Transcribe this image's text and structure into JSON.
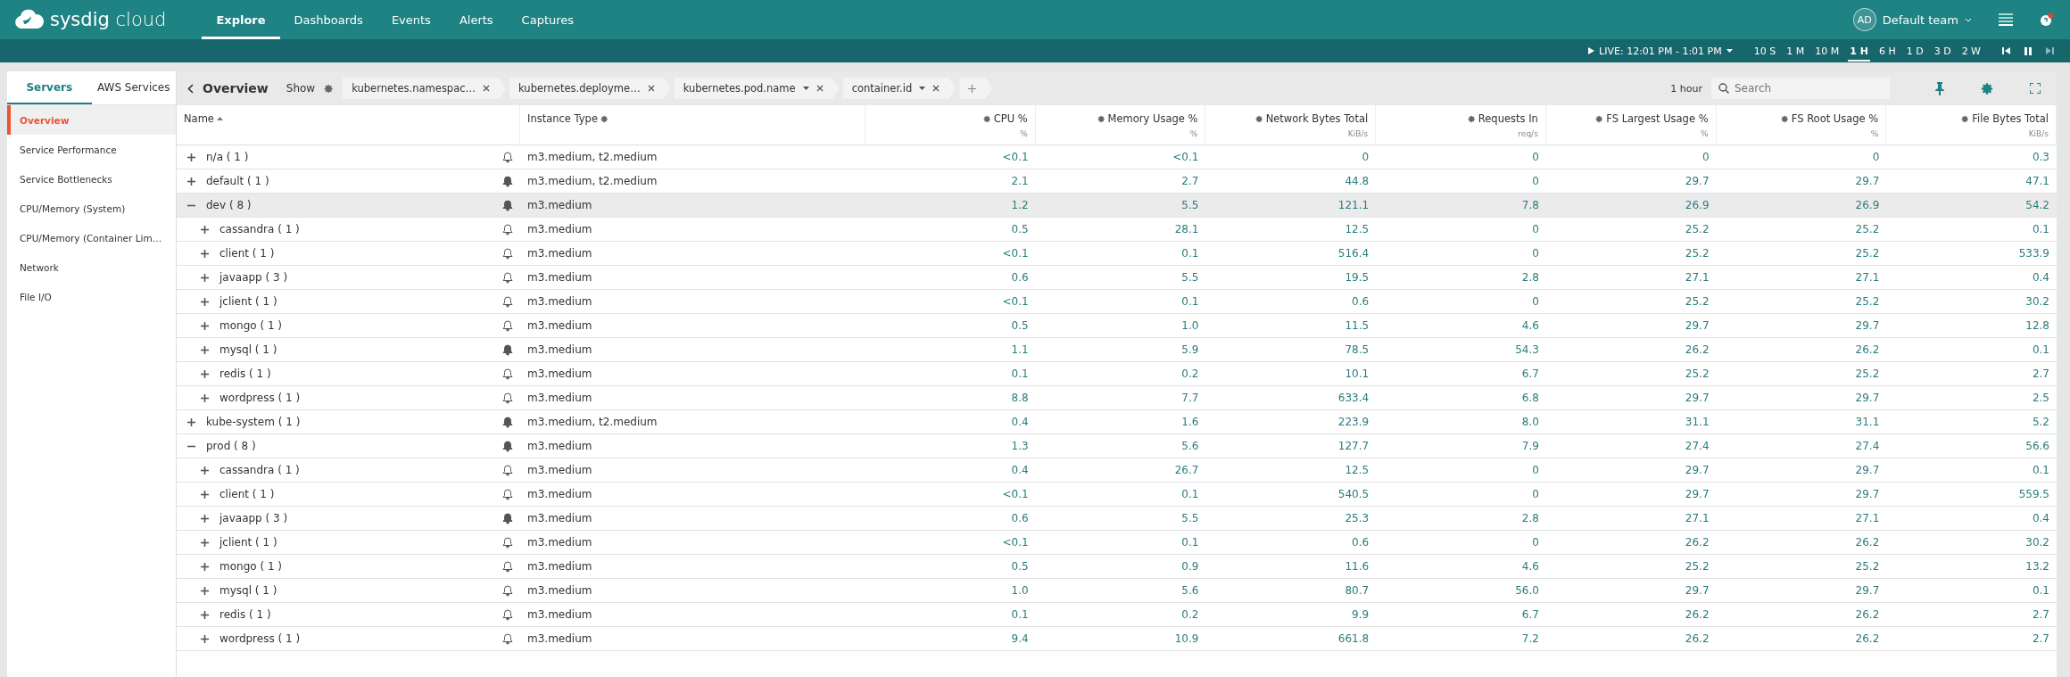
{
  "brand": {
    "name": "sysdig",
    "suffix": "cloud"
  },
  "nav": [
    {
      "label": "Explore",
      "selected": true
    },
    {
      "label": "Dashboards",
      "selected": false
    },
    {
      "label": "Events",
      "selected": false
    },
    {
      "label": "Alerts",
      "selected": false
    },
    {
      "label": "Captures",
      "selected": false
    }
  ],
  "team": {
    "initials": "AD",
    "name": "Default team"
  },
  "timebar": {
    "live": "LIVE: 12:01 PM - 1:01 PM",
    "ranges": [
      {
        "label": "10 S",
        "selected": false
      },
      {
        "label": "1 M",
        "selected": false
      },
      {
        "label": "10 M",
        "selected": false
      },
      {
        "label": "1 H",
        "selected": true
      },
      {
        "label": "6 H",
        "selected": false
      },
      {
        "label": "1 D",
        "selected": false
      },
      {
        "label": "3 D",
        "selected": false
      },
      {
        "label": "2 W",
        "selected": false
      }
    ]
  },
  "sidebar": {
    "tabs": [
      {
        "label": "Servers",
        "selected": true
      },
      {
        "label": "AWS Services",
        "selected": false
      }
    ],
    "items": [
      {
        "label": "Overview",
        "selected": true
      },
      {
        "label": "Service Performance",
        "selected": false
      },
      {
        "label": "Service Bottlenecks",
        "selected": false
      },
      {
        "label": "CPU/Memory (System)",
        "selected": false
      },
      {
        "label": "CPU/Memory (Container Lim…",
        "selected": false
      },
      {
        "label": "Network",
        "selected": false
      },
      {
        "label": "File I/O",
        "selected": false
      }
    ]
  },
  "toolbar": {
    "title": "Overview",
    "show": "Show",
    "chips": [
      {
        "label": "kubernetes.namespac…",
        "dropdown": false
      },
      {
        "label": "kubernetes.deployme…",
        "dropdown": false
      },
      {
        "label": "kubernetes.pod.name",
        "dropdown": true
      },
      {
        "label": "container.id",
        "dropdown": true
      }
    ],
    "range": "1 hour",
    "search": {
      "placeholder": "Search"
    }
  },
  "table": {
    "columns": [
      {
        "label": "Name",
        "kind": "name"
      },
      {
        "label": "Instance Type",
        "kind": "text"
      },
      {
        "label": "CPU %",
        "unit": "%",
        "kind": "num"
      },
      {
        "label": "Memory Usage %",
        "unit": "%",
        "kind": "num"
      },
      {
        "label": "Network Bytes Total",
        "unit": "KiB/s",
        "kind": "num"
      },
      {
        "label": "Requests In",
        "unit": "req/s",
        "kind": "num"
      },
      {
        "label": "FS Largest Usage %",
        "unit": "%",
        "kind": "num"
      },
      {
        "label": "FS Root Usage %",
        "unit": "%",
        "kind": "num"
      },
      {
        "label": "File Bytes Total",
        "unit": "KiB/s",
        "kind": "num"
      }
    ],
    "rows": [
      {
        "name": "n/a ( 1 )",
        "expanded": false,
        "selected": false,
        "alert": false,
        "instance": "m3.medium, t2.medium",
        "values": [
          "<0.1",
          "<0.1",
          "0",
          "0",
          "0",
          "0",
          "0.3"
        ]
      },
      {
        "name": "default ( 1 )",
        "expanded": false,
        "selected": false,
        "alert": true,
        "instance": "m3.medium, t2.medium",
        "values": [
          "2.1",
          "2.7",
          "44.8",
          "0",
          "29.7",
          "29.7",
          "47.1"
        ]
      },
      {
        "name": "dev ( 8 )",
        "expanded": true,
        "selected": true,
        "alert": true,
        "instance": "m3.medium",
        "values": [
          "1.2",
          "5.5",
          "121.1",
          "7.8",
          "26.9",
          "26.9",
          "54.2"
        ],
        "children": [
          {
            "name": "cassandra ( 1 )",
            "expanded": false,
            "selected": false,
            "alert": false,
            "instance": "m3.medium",
            "values": [
              "0.5",
              "28.1",
              "12.5",
              "0",
              "25.2",
              "25.2",
              "0.1"
            ]
          },
          {
            "name": "client ( 1 )",
            "expanded": false,
            "selected": false,
            "alert": false,
            "instance": "m3.medium",
            "values": [
              "<0.1",
              "0.1",
              "516.4",
              "0",
              "25.2",
              "25.2",
              "533.9"
            ]
          },
          {
            "name": "javaapp ( 3 )",
            "expanded": false,
            "selected": false,
            "alert": false,
            "instance": "m3.medium",
            "values": [
              "0.6",
              "5.5",
              "19.5",
              "2.8",
              "27.1",
              "27.1",
              "0.4"
            ]
          },
          {
            "name": "jclient ( 1 )",
            "expanded": false,
            "selected": false,
            "alert": false,
            "instance": "m3.medium",
            "values": [
              "<0.1",
              "0.1",
              "0.6",
              "0",
              "25.2",
              "25.2",
              "30.2"
            ]
          },
          {
            "name": "mongo ( 1 )",
            "expanded": false,
            "selected": false,
            "alert": false,
            "instance": "m3.medium",
            "values": [
              "0.5",
              "1.0",
              "11.5",
              "4.6",
              "29.7",
              "29.7",
              "12.8"
            ]
          },
          {
            "name": "mysql ( 1 )",
            "expanded": false,
            "selected": false,
            "alert": true,
            "instance": "m3.medium",
            "values": [
              "1.1",
              "5.9",
              "78.5",
              "54.3",
              "26.2",
              "26.2",
              "0.1"
            ]
          },
          {
            "name": "redis ( 1 )",
            "expanded": false,
            "selected": false,
            "alert": false,
            "instance": "m3.medium",
            "values": [
              "0.1",
              "0.2",
              "10.1",
              "6.7",
              "25.2",
              "25.2",
              "2.7"
            ]
          },
          {
            "name": "wordpress ( 1 )",
            "expanded": false,
            "selected": false,
            "alert": false,
            "instance": "m3.medium",
            "values": [
              "8.8",
              "7.7",
              "633.4",
              "6.8",
              "29.7",
              "29.7",
              "2.5"
            ]
          }
        ]
      },
      {
        "name": "kube-system ( 1 )",
        "expanded": false,
        "selected": false,
        "alert": true,
        "instance": "m3.medium, t2.medium",
        "values": [
          "0.4",
          "1.6",
          "223.9",
          "8.0",
          "31.1",
          "31.1",
          "5.2"
        ]
      },
      {
        "name": "prod ( 8 )",
        "expanded": true,
        "selected": false,
        "alert": true,
        "instance": "m3.medium",
        "values": [
          "1.3",
          "5.6",
          "127.7",
          "7.9",
          "27.4",
          "27.4",
          "56.6"
        ],
        "children": [
          {
            "name": "cassandra ( 1 )",
            "expanded": false,
            "selected": false,
            "alert": false,
            "instance": "m3.medium",
            "values": [
              "0.4",
              "26.7",
              "12.5",
              "0",
              "29.7",
              "29.7",
              "0.1"
            ]
          },
          {
            "name": "client ( 1 )",
            "expanded": false,
            "selected": false,
            "alert": false,
            "instance": "m3.medium",
            "values": [
              "<0.1",
              "0.1",
              "540.5",
              "0",
              "29.7",
              "29.7",
              "559.5"
            ]
          },
          {
            "name": "javaapp ( 3 )",
            "expanded": false,
            "selected": false,
            "alert": true,
            "instance": "m3.medium",
            "values": [
              "0.6",
              "5.5",
              "25.3",
              "2.8",
              "27.1",
              "27.1",
              "0.4"
            ]
          },
          {
            "name": "jclient ( 1 )",
            "expanded": false,
            "selected": false,
            "alert": false,
            "instance": "m3.medium",
            "values": [
              "<0.1",
              "0.1",
              "0.6",
              "0",
              "26.2",
              "26.2",
              "30.2"
            ]
          },
          {
            "name": "mongo ( 1 )",
            "expanded": false,
            "selected": false,
            "alert": false,
            "instance": "m3.medium",
            "values": [
              "0.5",
              "0.9",
              "11.6",
              "4.6",
              "25.2",
              "25.2",
              "13.2"
            ]
          },
          {
            "name": "mysql ( 1 )",
            "expanded": false,
            "selected": false,
            "alert": false,
            "instance": "m3.medium",
            "values": [
              "1.0",
              "5.6",
              "80.7",
              "56.0",
              "29.7",
              "29.7",
              "0.1"
            ]
          },
          {
            "name": "redis ( 1 )",
            "expanded": false,
            "selected": false,
            "alert": false,
            "instance": "m3.medium",
            "values": [
              "0.1",
              "0.2",
              "9.9",
              "6.7",
              "26.2",
              "26.2",
              "2.7"
            ]
          },
          {
            "name": "wordpress ( 1 )",
            "expanded": false,
            "selected": false,
            "alert": false,
            "instance": "m3.medium",
            "values": [
              "9.4",
              "10.9",
              "661.8",
              "7.2",
              "26.2",
              "26.2",
              "2.7"
            ]
          }
        ]
      }
    ]
  }
}
